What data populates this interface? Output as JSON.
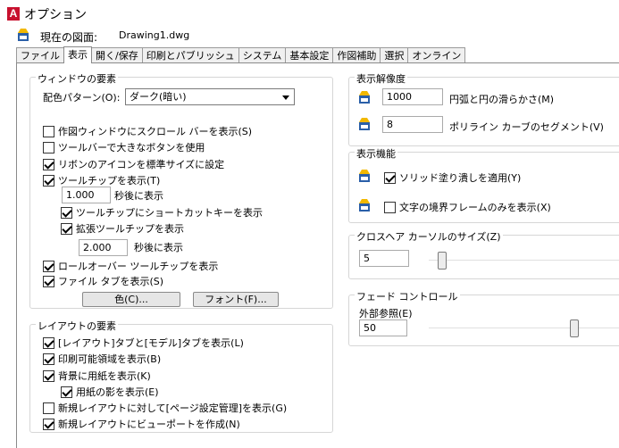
{
  "window": {
    "title": "オプション",
    "app_icon_letter": "A"
  },
  "drawing": {
    "label": "現在の図面:",
    "value": "Drawing1.dwg"
  },
  "tabs": [
    {
      "label": "ファイル",
      "active": false
    },
    {
      "label": "表示",
      "active": true
    },
    {
      "label": "開く/保存",
      "active": false
    },
    {
      "label": "印刷とパブリッシュ",
      "active": false
    },
    {
      "label": "システム",
      "active": false
    },
    {
      "label": "基本設定",
      "active": false
    },
    {
      "label": "作図補助",
      "active": false
    },
    {
      "label": "選択",
      "active": false
    },
    {
      "label": "オンライン",
      "active": false
    }
  ],
  "window_elements": {
    "title": "ウィンドウの要素",
    "color_scheme_label": "配色パターン(O):",
    "color_scheme_value": "ダーク(暗い)",
    "scrollbars": {
      "label": "作図ウィンドウにスクロール バーを表示(S)",
      "checked": false
    },
    "large_buttons": {
      "label": "ツールバーで大きなボタンを使用",
      "checked": false
    },
    "ribbon_icons": {
      "label": "リボンのアイコンを標準サイズに設定",
      "checked": true
    },
    "tooltips": {
      "label": "ツールチップを表示(T)",
      "checked": true
    },
    "tooltip_delay_value": "1.000",
    "tooltip_delay_label": "秒後に表示",
    "shortcut_keys": {
      "label": "ツールチップにショートカットキーを表示",
      "checked": true
    },
    "extended_tooltips": {
      "label": "拡張ツールチップを表示",
      "checked": true
    },
    "extended_delay_value": "2.000",
    "extended_delay_label": "秒後に表示",
    "rollover": {
      "label": "ロールオーバー ツールチップを表示",
      "checked": true
    },
    "file_tabs": {
      "label": "ファイル タブを表示(S)",
      "checked": true
    },
    "colors_button": "色(C)...",
    "fonts_button": "フォント(F)..."
  },
  "layout_elements": {
    "title": "レイアウトの要素",
    "layout_model_tabs": {
      "label": "[レイアウト]タブと[モデル]タブを表示(L)",
      "checked": true
    },
    "printable_area": {
      "label": "印刷可能領域を表示(B)",
      "checked": true
    },
    "paper_background": {
      "label": "背景に用紙を表示(K)",
      "checked": true
    },
    "paper_shadow": {
      "label": "用紙の影を表示(E)",
      "checked": true
    },
    "page_setup_manager": {
      "label": "新規レイアウトに対して[ページ設定管理]を表示(G)",
      "checked": false
    },
    "create_viewport": {
      "label": "新規レイアウトにビューポートを作成(N)",
      "checked": true
    }
  },
  "display_resolution": {
    "title": "表示解像度",
    "arc_smoothness_value": "1000",
    "arc_smoothness_label": "円弧と円の滑らかさ(M)",
    "polyline_segments_value": "8",
    "polyline_segments_label": "ポリライン カーブのセグメント(V)"
  },
  "display_performance": {
    "title": "表示機能",
    "solid_fill": {
      "label": "ソリッド塗り潰しを適用(Y)",
      "checked": true
    },
    "text_frame": {
      "label": "文字の境界フレームのみを表示(X)",
      "checked": false
    }
  },
  "crosshair": {
    "title": "クロスヘア カーソルのサイズ(Z)",
    "value": "5",
    "slider_fraction": 0.05
  },
  "fade_control": {
    "title": "フェード コントロール",
    "xref_label": "外部参照(E)",
    "xref_value": "50",
    "slider_fraction": 0.78
  },
  "colors": {
    "accent_red": "#c8102e"
  }
}
